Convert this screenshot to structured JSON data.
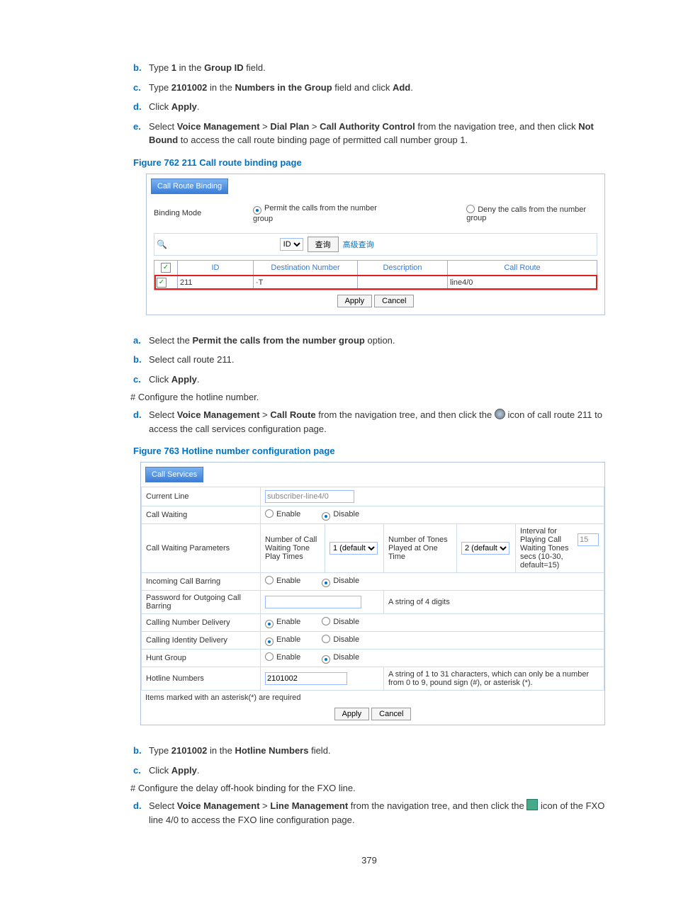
{
  "steps1": [
    {
      "m": "b.",
      "t": "Type <b>1</b> in the <b>Group ID</b> field."
    },
    {
      "m": "c.",
      "t": "Type <b>2101002</b> in the <b>Numbers in the Group</b> field and click <b>Add</b>."
    },
    {
      "m": "d.",
      "t": "Click <b>Apply</b>."
    },
    {
      "m": "e.",
      "t": "Select <b>Voice Management</b> > <b>Dial Plan</b> > <b>Call Authority Control</b> from the navigation tree, and then click <b>Not Bound</b> to access the call route binding page of permitted call number group 1."
    }
  ],
  "fig1": "Figure 762 211 Call route binding page",
  "p1": {
    "tab": "Call Route Binding",
    "mode_label": "Binding Mode",
    "opt_permit": "Permit the calls from the number group",
    "opt_deny": "Deny the calls from the number group",
    "search_sel": "ID",
    "search_btn": "查询",
    "adv": "高级查询",
    "cols": [
      "",
      "ID",
      "Destination Number",
      "Description",
      "Call Route"
    ],
    "row": [
      "211",
      "·T",
      "",
      "line4/0"
    ],
    "apply": "Apply",
    "cancel": "Cancel"
  },
  "steps2": [
    {
      "m": "a.",
      "t": "Select the <b>Permit the calls from the number group</b> option."
    },
    {
      "m": "b.",
      "t": "Select call route 211."
    },
    {
      "m": "c.",
      "t": "Click <b>Apply</b>."
    }
  ],
  "hash1": "# Configure the hotline number.",
  "step_d": {
    "m": "d.",
    "pre": "Select <b>Voice Management</b> > <b>Call Route</b> from the navigation tree, and then click the ",
    "post": " icon of call route 211 to access the call services configuration page."
  },
  "fig2": "Figure 763 Hotline number configuration page",
  "p2": {
    "tab": "Call Services",
    "cur_line_lbl": "Current Line",
    "cur_line": "subscriber-line4/0",
    "cw_lbl": "Call Waiting",
    "enable": "Enable",
    "disable": "Disable",
    "cwp_lbl": "Call Waiting Parameters",
    "cwp_a": "Number of Call Waiting Tone Play Times",
    "cwp_a_val": "1 (default",
    "cwp_b": "Number of Tones Played at One Time",
    "cwp_b_val": "2 (default",
    "cwp_c": "Interval for Playing Call Waiting Tones",
    "cwp_c_val": "15",
    "cwp_c_hint": "secs (10-30, default=15)",
    "icb_lbl": "Incoming Call Barring",
    "pwd_lbl": "Password for Outgoing Call Barring",
    "pwd_hint": "A string of 4 digits",
    "cnd_lbl": "Calling Number Delivery",
    "cid_lbl": "Calling Identity Delivery",
    "hg_lbl": "Hunt Group",
    "hl_lbl": "Hotline Numbers",
    "hl_val": "2101002",
    "hl_hint": "A string of 1 to 31 characters, which can only be a number from 0 to 9, pound sign (#), or asterisk (*).",
    "req": "Items marked with an asterisk(*) are required",
    "apply": "Apply",
    "cancel": "Cancel"
  },
  "steps3": [
    {
      "m": "b.",
      "t": "Type <b>2101002</b> in the <b>Hotline Numbers</b> field."
    },
    {
      "m": "c.",
      "t": "Click <b>Apply</b>."
    }
  ],
  "hash2": "# Configure the delay off-hook binding for the FXO line.",
  "step_d2": {
    "m": "d.",
    "pre": "Select <b>Voice Management</b> > <b>Line Management</b> from the navigation tree, and then click the ",
    "post": " icon of the FXO line 4/0 to access the FXO line configuration page."
  },
  "pnum": "379"
}
